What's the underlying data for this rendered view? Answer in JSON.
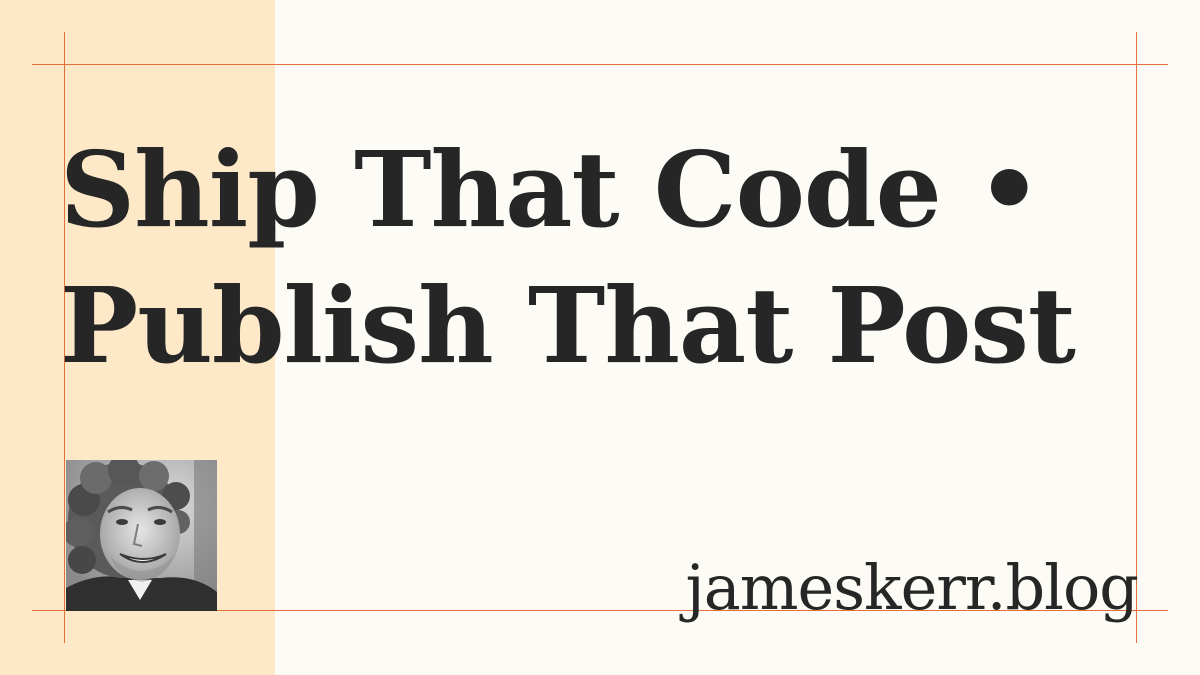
{
  "headline": {
    "line1": "Ship That Code •",
    "line2": "Publish That Post"
  },
  "author": {
    "photo_icon": "author-portrait-photo"
  },
  "site": {
    "domain": "jameskerr.blog"
  },
  "colors": {
    "background": "#fdfbf6",
    "side_band": "#fde9c8",
    "guide_lines": "#e2703a",
    "text": "#262626"
  }
}
